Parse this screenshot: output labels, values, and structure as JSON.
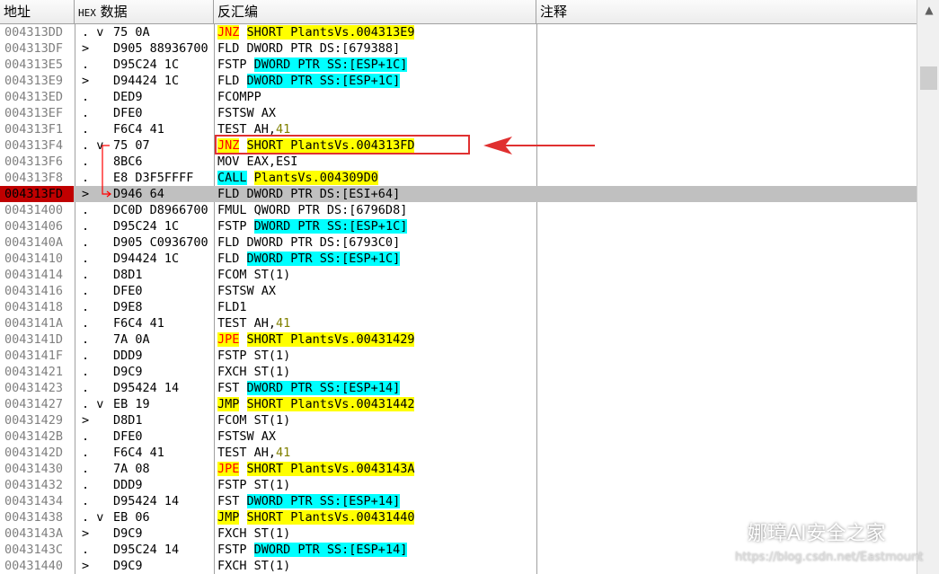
{
  "header": {
    "col_address": "地址",
    "col_hex_prefix": "HEX",
    "col_hex": "数据",
    "col_disasm": "反汇编",
    "col_comment": "注释"
  },
  "rows": [
    {
      "addr": "004313DD",
      "mark": ". v",
      "hex": "75 0A",
      "asm": [
        {
          "t": "JNZ",
          "s": "r"
        },
        {
          "t": " "
        },
        {
          "t": "SHORT PlantsVs.004313E9",
          "s": "y"
        }
      ]
    },
    {
      "addr": "004313DF",
      "mark": " >",
      "hex": "D905 88936700",
      "asm": [
        {
          "t": "FLD DWORD PTR DS:[679388]"
        }
      ]
    },
    {
      "addr": "004313E5",
      "mark": " .",
      "hex": "D95C24 1C",
      "asm": [
        {
          "t": "FSTP "
        },
        {
          "t": "DWORD PTR SS:[ESP+1C]",
          "s": "c"
        }
      ]
    },
    {
      "addr": "004313E9",
      "mark": " >",
      "hex": "D94424 1C",
      "asm": [
        {
          "t": "FLD "
        },
        {
          "t": "DWORD PTR SS:[ESP+1C]",
          "s": "c"
        }
      ]
    },
    {
      "addr": "004313ED",
      "mark": " .",
      "hex": "DED9",
      "asm": [
        {
          "t": "FCOMPP"
        }
      ]
    },
    {
      "addr": "004313EF",
      "mark": " .",
      "hex": "DFE0",
      "asm": [
        {
          "t": "FSTSW AX"
        }
      ]
    },
    {
      "addr": "004313F1",
      "mark": " .",
      "hex": "F6C4 41",
      "asm": [
        {
          "t": "TEST AH,"
        },
        {
          "t": "41",
          "s": "n"
        }
      ]
    },
    {
      "addr": "004313F4",
      "mark": ". v",
      "hex": "75 07",
      "asm": [
        {
          "t": "JNZ",
          "s": "r"
        },
        {
          "t": " "
        },
        {
          "t": "SHORT PlantsVs.004313FD",
          "s": "y"
        }
      ]
    },
    {
      "addr": "004313F6",
      "mark": " .",
      "hex": "8BC6",
      "asm": [
        {
          "t": "MOV EAX,ESI"
        }
      ]
    },
    {
      "addr": "004313F8",
      "mark": " .",
      "hex": "E8 D3F5FFFF",
      "asm": [
        {
          "t": "CALL",
          "s": "c"
        },
        {
          "t": " "
        },
        {
          "t": "PlantsVs.004309D0",
          "s": "y"
        }
      ]
    },
    {
      "addr": "004313FD",
      "mark": " >",
      "hex": "D946 64",
      "asm": [
        {
          "t": "FLD DWORD PTR DS:[ESI+64]"
        }
      ],
      "sel": true
    },
    {
      "addr": "00431400",
      "mark": " .",
      "hex": "DC0D D8966700",
      "asm": [
        {
          "t": "FMUL QWORD PTR DS:[6796D8]"
        }
      ]
    },
    {
      "addr": "00431406",
      "mark": " .",
      "hex": "D95C24 1C",
      "asm": [
        {
          "t": "FSTP "
        },
        {
          "t": "DWORD PTR SS:[ESP+1C]",
          "s": "c"
        }
      ]
    },
    {
      "addr": "0043140A",
      "mark": " .",
      "hex": "D905 C0936700",
      "asm": [
        {
          "t": "FLD DWORD PTR DS:[6793C0]"
        }
      ]
    },
    {
      "addr": "00431410",
      "mark": " .",
      "hex": "D94424 1C",
      "asm": [
        {
          "t": "FLD "
        },
        {
          "t": "DWORD PTR SS:[ESP+1C]",
          "s": "c"
        }
      ]
    },
    {
      "addr": "00431414",
      "mark": " .",
      "hex": "D8D1",
      "asm": [
        {
          "t": "FCOM ST(1)"
        }
      ]
    },
    {
      "addr": "00431416",
      "mark": " .",
      "hex": "DFE0",
      "asm": [
        {
          "t": "FSTSW AX"
        }
      ]
    },
    {
      "addr": "00431418",
      "mark": " .",
      "hex": "D9E8",
      "asm": [
        {
          "t": "FLD1"
        }
      ]
    },
    {
      "addr": "0043141A",
      "mark": " .",
      "hex": "F6C4 41",
      "asm": [
        {
          "t": "TEST AH,"
        },
        {
          "t": "41",
          "s": "n"
        }
      ]
    },
    {
      "addr": "0043141D",
      "mark": " .",
      "hex": "7A 0A",
      "asm": [
        {
          "t": "JPE",
          "s": "r"
        },
        {
          "t": " "
        },
        {
          "t": "SHORT PlantsVs.00431429",
          "s": "y"
        }
      ]
    },
    {
      "addr": "0043141F",
      "mark": " .",
      "hex": "DDD9",
      "asm": [
        {
          "t": "FSTP ST(1)"
        }
      ]
    },
    {
      "addr": "00431421",
      "mark": " .",
      "hex": "D9C9",
      "asm": [
        {
          "t": "FXCH ST(1)"
        }
      ]
    },
    {
      "addr": "00431423",
      "mark": " .",
      "hex": "D95424 14",
      "asm": [
        {
          "t": "FST "
        },
        {
          "t": "DWORD PTR SS:[ESP+14]",
          "s": "c"
        }
      ]
    },
    {
      "addr": "00431427",
      "mark": ". v",
      "hex": "EB 19",
      "asm": [
        {
          "t": "JMP",
          "s": "y"
        },
        {
          "t": " "
        },
        {
          "t": "SHORT PlantsVs.00431442",
          "s": "y"
        }
      ]
    },
    {
      "addr": "00431429",
      "mark": " >",
      "hex": "D8D1",
      "asm": [
        {
          "t": "FCOM ST(1)"
        }
      ]
    },
    {
      "addr": "0043142B",
      "mark": " .",
      "hex": "DFE0",
      "asm": [
        {
          "t": "FSTSW AX"
        }
      ]
    },
    {
      "addr": "0043142D",
      "mark": " .",
      "hex": "F6C4 41",
      "asm": [
        {
          "t": "TEST AH,"
        },
        {
          "t": "41",
          "s": "n"
        }
      ]
    },
    {
      "addr": "00431430",
      "mark": " .",
      "hex": "7A 08",
      "asm": [
        {
          "t": "JPE",
          "s": "r"
        },
        {
          "t": " "
        },
        {
          "t": "SHORT PlantsVs.0043143A",
          "s": "y"
        }
      ]
    },
    {
      "addr": "00431432",
      "mark": " .",
      "hex": "DDD9",
      "asm": [
        {
          "t": "FSTP ST(1)"
        }
      ]
    },
    {
      "addr": "00431434",
      "mark": " .",
      "hex": "D95424 14",
      "asm": [
        {
          "t": "FST "
        },
        {
          "t": "DWORD PTR SS:[ESP+14]",
          "s": "c"
        }
      ]
    },
    {
      "addr": "00431438",
      "mark": ". v",
      "hex": "EB 06",
      "asm": [
        {
          "t": "JMP",
          "s": "y"
        },
        {
          "t": " "
        },
        {
          "t": "SHORT PlantsVs.00431440",
          "s": "y"
        }
      ]
    },
    {
      "addr": "0043143A",
      "mark": " >",
      "hex": "D9C9",
      "asm": [
        {
          "t": "FXCH ST(1)"
        }
      ]
    },
    {
      "addr": "0043143C",
      "mark": " .",
      "hex": "D95C24 14",
      "asm": [
        {
          "t": "FSTP "
        },
        {
          "t": "DWORD PTR SS:[ESP+14]",
          "s": "c"
        }
      ]
    },
    {
      "addr": "00431440",
      "mark": " >",
      "hex": "D9C9",
      "asm": [
        {
          "t": "FXCH ST(1)"
        }
      ]
    }
  ],
  "watermark": {
    "text": "娜璋AI安全之家",
    "url": "https://blog.csdn.net/Eastmount"
  },
  "colors": {
    "yellow": "#ffff00",
    "cyan": "#00ffff",
    "red": "#ff0000",
    "selected_address": "#c00000",
    "annotation": "#e03030"
  },
  "icons": {
    "scroll_up": "chevron-up-icon",
    "watermark": "wechat-logo-icon"
  }
}
